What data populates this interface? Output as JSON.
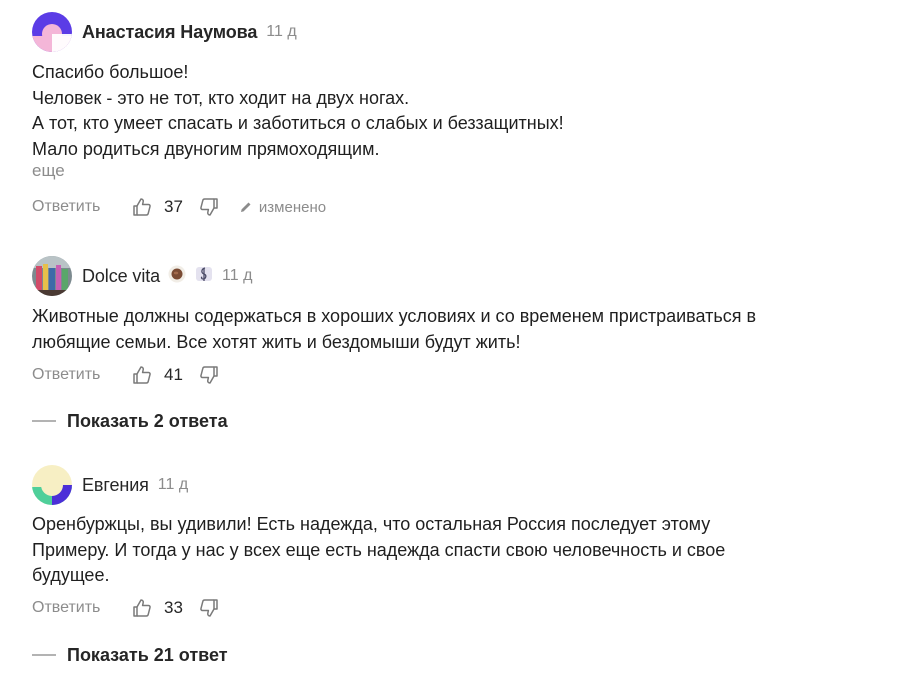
{
  "comments": [
    {
      "author": "Анастасия Наумова",
      "time": "11 д",
      "text": [
        "Спасибо большое!",
        "Человек - это не тот, кто ходит на двух ногах.",
        "А тот, кто умеет спасать и заботиться о слабых и беззащитных!",
        "Мало родиться двуногим прямоходящим."
      ],
      "more_label": "еще",
      "reply_label": "Ответить",
      "likes": "37",
      "edited_label": "изменено",
      "avatar_colors": [
        "#5b3ce6",
        "#f4b6d8"
      ]
    },
    {
      "author": "Dolce vita",
      "time": "11 д",
      "text": [
        "Животные должны содержаться в хороших условиях и со временем пристраиваться в",
        "любящие семьи. Все хотят жить и бездомыши будут жить!"
      ],
      "reply_label": "Ответить",
      "likes": "41",
      "badge_icons": [
        "coffee-cup-badge-icon",
        "music-note-badge-icon"
      ],
      "show_replies_label": "Показать 2 ответа"
    },
    {
      "author": "Евгения",
      "time": "11 д",
      "text": [
        "Оренбуржцы, вы удивили! Есть надежда, что остальная Россия последует этому",
        "Примеру. И тогда у нас у всех еще есть надежда спасти свою человечность и свое",
        "будущее."
      ],
      "reply_label": "Ответить",
      "likes": "33",
      "avatar_colors": [
        "#f7efc4",
        "#4fcf9a",
        "#4b2fd8"
      ],
      "show_replies_label": "Показать 21 ответ"
    }
  ],
  "colors": {
    "text": "#1f1f1f",
    "muted": "#8c8c8c",
    "accent": "#5b3ce6"
  }
}
